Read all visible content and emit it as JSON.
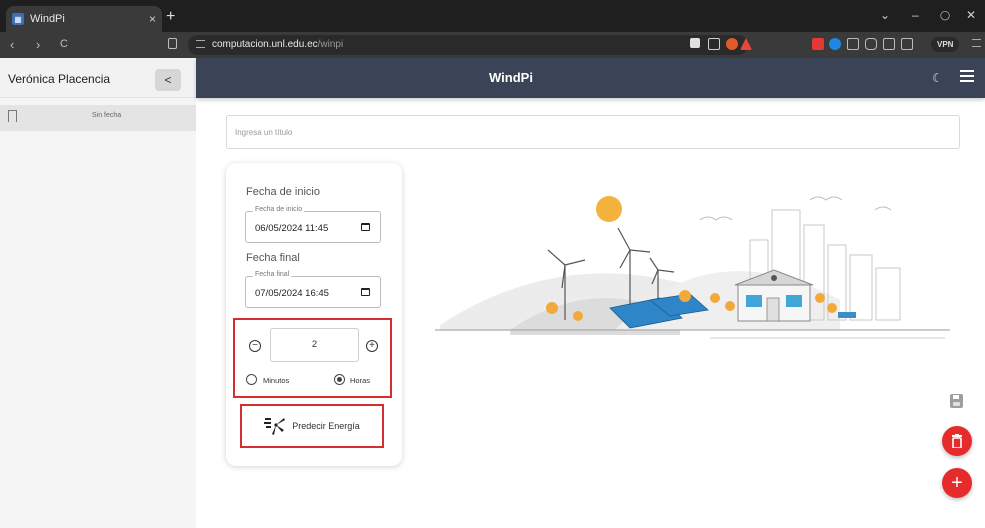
{
  "browser": {
    "tab_title": "WindPi",
    "tab_close": "×",
    "new_tab": "+",
    "url_host": "computacion.unl.edu.ec",
    "url_path": "/winpi",
    "vpn_label": "VPN",
    "window_controls": [
      "⌄",
      "–",
      "◯",
      "✕"
    ],
    "nav": [
      "‹",
      "›",
      "C"
    ]
  },
  "sidebar": {
    "user_name": "Verónica Placencia",
    "collapse_glyph": "<",
    "entries": [
      {
        "label": "Sin fecha"
      }
    ]
  },
  "header": {
    "title": "WindPi"
  },
  "title_input": {
    "placeholder": "Ingresa un título",
    "value": ""
  },
  "form": {
    "start": {
      "section_label": "Fecha de inicio",
      "legend": "Fecha de inicio",
      "value": "06/05/2024 11:45"
    },
    "end": {
      "section_label": "Fecha final",
      "legend": "Fecha final",
      "value": "07/05/2024 16:45"
    },
    "counter": {
      "value": "2",
      "minus": "−",
      "plus": "+"
    },
    "units": {
      "options": [
        "Minutos",
        "Horas"
      ],
      "selected": "Horas"
    },
    "predict_button": "Predecir Energía"
  },
  "colors": {
    "appbar": "#3a4456",
    "accent_red": "#e52b2b",
    "highlight_red": "#d32f2f"
  },
  "icons": [
    "windpi-favicon",
    "bookmark-icon",
    "theme-icon",
    "menu-icon",
    "calendar-icon",
    "minus-circle-icon",
    "plus-circle-icon",
    "wind-energy-icon",
    "save-icon",
    "delete-icon",
    "add-icon"
  ]
}
